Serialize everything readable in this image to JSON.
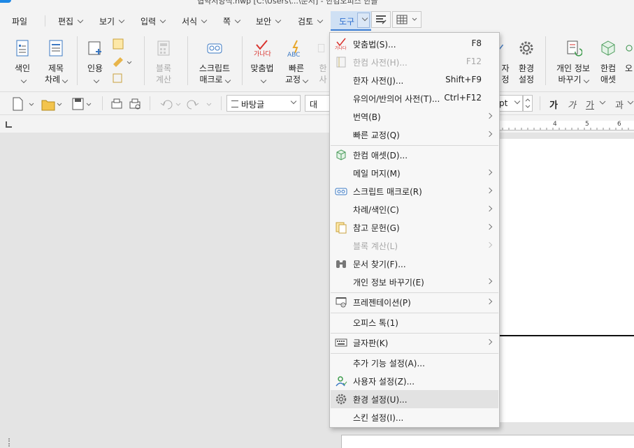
{
  "window": {
    "title": "협약서양식.hwp [C:\\Users\\...\\문서] - 한컴오피스 한글"
  },
  "menubar": {
    "items": [
      "파일",
      "편집",
      "보기",
      "입력",
      "서식",
      "쪽",
      "보안",
      "검토",
      "도구"
    ]
  },
  "ribbon": {
    "buttons": [
      {
        "line1": "색인",
        "line2": ""
      },
      {
        "line1": "제목",
        "line2": "차례"
      },
      {
        "line1": "인용",
        "line2": ""
      },
      {
        "line1": "블록",
        "line2": "계산"
      },
      {
        "line1": "스크립트",
        "line2": "매크로"
      },
      {
        "line1": "맞춤법",
        "line2": ""
      },
      {
        "line1": "빠른",
        "line2": "교정"
      },
      {
        "line1": "한",
        "line2": "사"
      },
      {
        "line1": "자",
        "line2": "정"
      },
      {
        "line1": "환경",
        "line2": "설정"
      },
      {
        "line1": "개인 정보",
        "line2": "바꾸기"
      },
      {
        "line1": "한컴",
        "line2": "애셋"
      },
      {
        "line1": "오",
        "line2": ""
      }
    ]
  },
  "format_toolbar": {
    "style_value": "바탕글",
    "font_value": "대표",
    "size_unit": "pt",
    "char_buttons": [
      "가",
      "가",
      "가",
      "과"
    ]
  },
  "ruler": {
    "ticks": [
      "4",
      "5",
      "6"
    ]
  },
  "tools_menu": {
    "items": [
      {
        "label": "맞춤법(S)...",
        "shortcut": "F8",
        "icon": "spellcheck-icon",
        "disabled": false,
        "submenu": false
      },
      {
        "label": "한컴 사전(H)...",
        "shortcut": "F12",
        "icon": "dictionary-icon",
        "disabled": true,
        "submenu": false
      },
      {
        "label": "한자 사전(J)...",
        "shortcut": "Shift+F9",
        "icon": "",
        "disabled": false,
        "submenu": false
      },
      {
        "label": "유의어/반의어 사전(T)...",
        "shortcut": "Ctrl+F12",
        "icon": "",
        "disabled": false,
        "submenu": false
      },
      {
        "label": "번역(B)",
        "shortcut": "",
        "icon": "",
        "disabled": false,
        "submenu": true
      },
      {
        "label": "빠른 교정(Q)",
        "shortcut": "",
        "icon": "",
        "disabled": false,
        "submenu": true
      },
      {
        "label": "한컴 애셋(D)...",
        "shortcut": "",
        "icon": "asset-cube-icon",
        "disabled": false,
        "submenu": false
      },
      {
        "label": "메일 머지(M)",
        "shortcut": "",
        "icon": "",
        "disabled": false,
        "submenu": true
      },
      {
        "label": "스크립트 매크로(R)",
        "shortcut": "",
        "icon": "macro-tape-icon",
        "disabled": false,
        "submenu": true
      },
      {
        "label": "차례/색인(C)",
        "shortcut": "",
        "icon": "",
        "disabled": false,
        "submenu": true
      },
      {
        "label": "참고 문헌(G)",
        "shortcut": "",
        "icon": "citation-icon",
        "disabled": false,
        "submenu": true
      },
      {
        "label": "블록 계산(L)",
        "shortcut": "",
        "icon": "",
        "disabled": true,
        "submenu": true
      },
      {
        "label": "문서 찾기(F)...",
        "shortcut": "",
        "icon": "binoculars-icon",
        "disabled": false,
        "submenu": false
      },
      {
        "label": "개인 정보 바꾸기(E)",
        "shortcut": "",
        "icon": "",
        "disabled": false,
        "submenu": true
      },
      {
        "label": "프레젠테이션(P)",
        "shortcut": "",
        "icon": "presentation-icon",
        "disabled": false,
        "submenu": true
      },
      {
        "label": "오피스 톡(1)",
        "shortcut": "",
        "icon": "",
        "disabled": false,
        "submenu": false
      },
      {
        "label": "글자판(K)",
        "shortcut": "",
        "icon": "keyboard-icon",
        "disabled": false,
        "submenu": true
      },
      {
        "label": "추가 기능 설정(A)...",
        "shortcut": "",
        "icon": "",
        "disabled": false,
        "submenu": false
      },
      {
        "label": "사용자 설정(Z)...",
        "shortcut": "",
        "icon": "user-settings-icon",
        "disabled": false,
        "submenu": false
      },
      {
        "label": "환경 설정(U)...",
        "shortcut": "",
        "icon": "gear-icon",
        "disabled": false,
        "submenu": false
      },
      {
        "label": "스킨 설정(I)...",
        "shortcut": "",
        "icon": "",
        "disabled": false,
        "submenu": false
      }
    ]
  }
}
